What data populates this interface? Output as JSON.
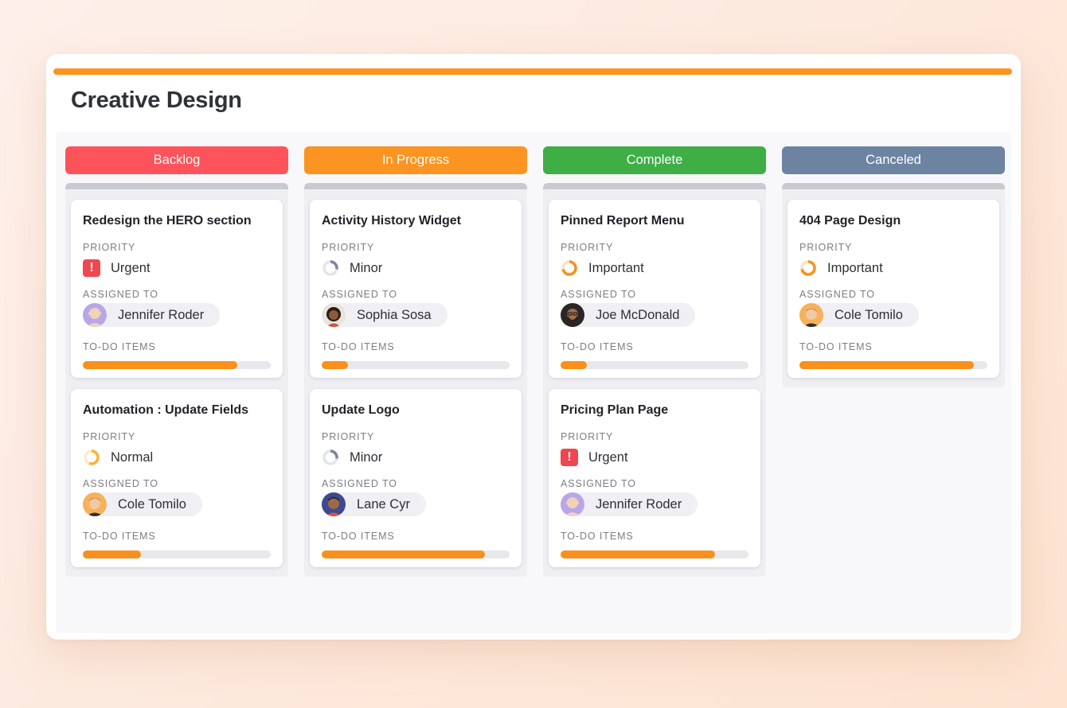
{
  "page_title": "Creative Design",
  "labels": {
    "priority": "PRIORITY",
    "assigned_to": "ASSIGNED TO",
    "todo_items": "TO-DO ITEMS"
  },
  "colors": {
    "accent": "#fb9420",
    "backlog": "#fe535b",
    "in_progress": "#fb9420",
    "complete": "#3eae45",
    "canceled": "#6c84a1",
    "urgent": "#ee4752",
    "progress_fill": "#f9901b"
  },
  "columns": [
    {
      "name": "Backlog",
      "color": "#fe535b",
      "cards": [
        {
          "title": "Redesign the HERO section",
          "priority": "Urgent",
          "priority_icon": "urgent-icon",
          "assignee": "Jennifer Roder",
          "avatar": "avatar-jennifer",
          "progress": 0.82
        },
        {
          "title": "Automation : Update Fields",
          "priority": "Normal",
          "priority_icon": "normal-priority-icon",
          "assignee": "Cole Tomilo",
          "avatar": "avatar-cole",
          "progress": 0.31
        }
      ]
    },
    {
      "name": "In Progress",
      "color": "#fb9420",
      "cards": [
        {
          "title": "Activity History Widget",
          "priority": "Minor",
          "priority_icon": "minor-priority-icon",
          "assignee": "Sophia Sosa",
          "avatar": "avatar-sophia",
          "progress": 0.14
        },
        {
          "title": "Update Logo",
          "priority": "Minor",
          "priority_icon": "minor-priority-icon",
          "assignee": "Lane Cyr",
          "avatar": "avatar-lane",
          "progress": 0.87
        }
      ]
    },
    {
      "name": "Complete",
      "color": "#3eae45",
      "cards": [
        {
          "title": "Pinned Report Menu",
          "priority": "Important",
          "priority_icon": "important-priority-icon",
          "assignee": "Joe McDonald",
          "avatar": "avatar-joe",
          "progress": 0.14
        },
        {
          "title": "Pricing Plan Page",
          "priority": "Urgent",
          "priority_icon": "urgent-icon",
          "assignee": "Jennifer Roder",
          "avatar": "avatar-jennifer",
          "progress": 0.82
        }
      ]
    },
    {
      "name": "Canceled",
      "color": "#6c84a1",
      "cards": [
        {
          "title": "404 Page Design",
          "priority": "Important",
          "priority_icon": "important-priority-icon",
          "assignee": "Cole Tomilo",
          "avatar": "avatar-cole",
          "progress": 0.93
        }
      ]
    }
  ]
}
